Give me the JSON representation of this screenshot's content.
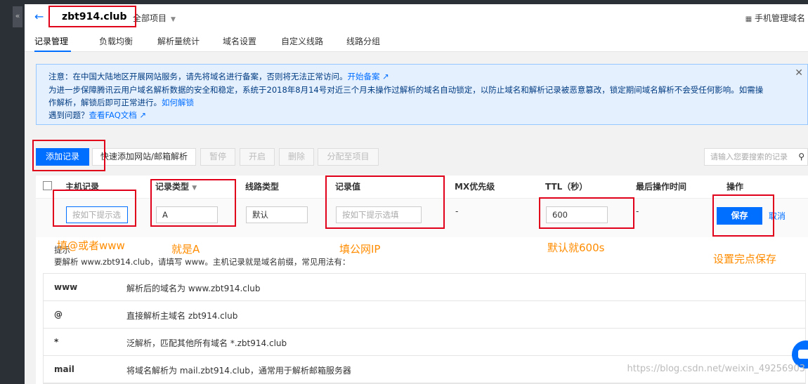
{
  "header": {
    "title": "zbt914.club",
    "project_select": "全部项目",
    "mobile_link": "手机管理域名"
  },
  "tabs": [
    "记录管理",
    "负载均衡",
    "解析量统计",
    "域名设置",
    "自定义线路",
    "线路分组"
  ],
  "notice": {
    "line1": "注意：在中国大陆地区开展网站服务，请先将域名进行备案，否则将无法正常访问。",
    "line1_link": "开始备案",
    "line2": "为进一步保障腾讯云用户域名解析数据的安全和稳定，系统于2018年8月14号对近三个月未操作过解析的域名自动锁定，以防止域名和解析记录被恶意篡改，锁定期间域名解析不会受任何影响。如需操",
    "line3": "作解析，解锁后即可正常进行。",
    "line3_link": "如何解锁",
    "line4": "遇到问题？",
    "line4_link": "查看FAQ文档"
  },
  "toolbar": {
    "add": "添加记录",
    "quick_add": "快速添加网站/邮箱解析",
    "pause": "暂停",
    "enable": "开启",
    "delete": "删除",
    "assign": "分配至项目",
    "search_placeholder": "请输入您要搜索的记录"
  },
  "table": {
    "headers": [
      "主机记录",
      "记录类型",
      "线路类型",
      "记录值",
      "MX优先级",
      "TTL（秒）",
      "最后操作时间",
      "操作"
    ],
    "edit_row": {
      "host_placeholder": "按如下提示选",
      "type": "A",
      "line": "默认",
      "value_placeholder": "按如下提示选填",
      "mx": "-",
      "ttl": "600",
      "last_op": "-",
      "save": "保存",
      "cancel": "取消"
    }
  },
  "hint": {
    "title": "提示",
    "text": "要解析 www.zbt914.club，请填写 www。主机记录就是域名前缀，常见用法有：",
    "rows": [
      {
        "k": "www",
        "v": "解析后的域名为 www.zbt914.club"
      },
      {
        "k": "@",
        "v": "直接解析主域名 zbt914.club"
      },
      {
        "k": "*",
        "v": "泛解析，匹配其他所有域名 *.zbt914.club"
      },
      {
        "k": "mail",
        "v": "将域名解析为 mail.zbt914.club，通常用于解析邮箱服务器"
      }
    ]
  },
  "annotations": {
    "host": "填@或者www",
    "type": "就是A",
    "value": "填公网IP",
    "ttl": "默认就600s",
    "save": "设置完点保存"
  },
  "watermark": "https://blog.csdn.net/weixin_49256903",
  "colors": {
    "accent": "#006eff",
    "annotation_box": "#e0001a",
    "annotation_text": "#ff8c00"
  }
}
